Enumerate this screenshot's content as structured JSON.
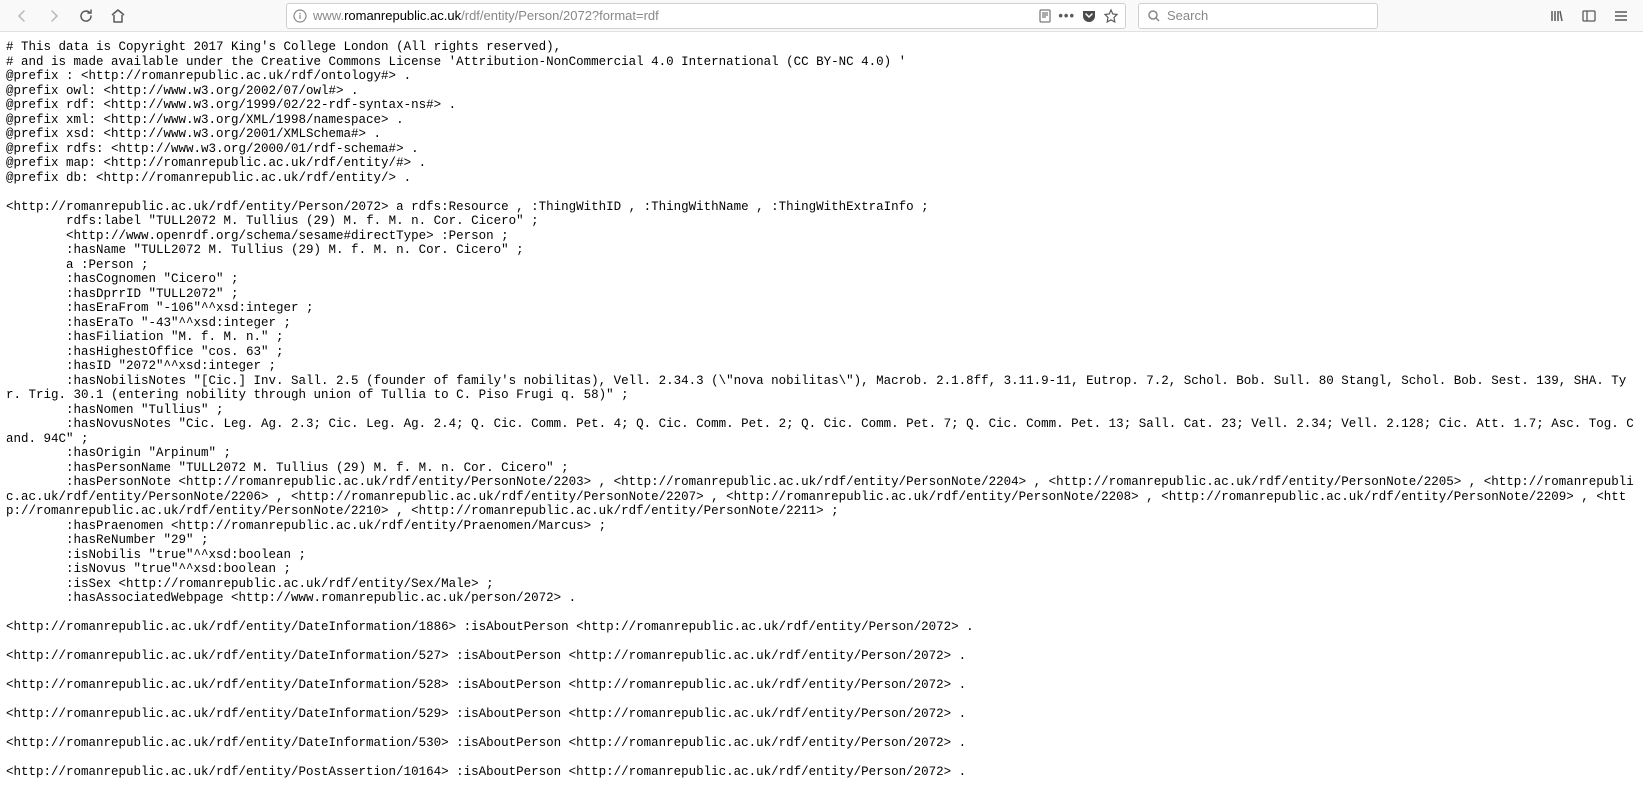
{
  "browser": {
    "url_prefix": "www.",
    "url_domain": "romanrepublic.ac.uk",
    "url_path": "/rdf/entity/Person/2072?format=rdf",
    "search_placeholder": "Search"
  },
  "rdf": {
    "comment1": "# This data is Copyright 2017 King's College London (All rights reserved),",
    "comment2": "# and is made available under the Creative Commons License 'Attribution-NonCommercial 4.0 International (CC BY-NC 4.0) '",
    "prefixes": [
      "@prefix : <http://romanrepublic.ac.uk/rdf/ontology#> .",
      "@prefix owl: <http://www.w3.org/2002/07/owl#> .",
      "@prefix rdf: <http://www.w3.org/1999/02/22-rdf-syntax-ns#> .",
      "@prefix xml: <http://www.w3.org/XML/1998/namespace> .",
      "@prefix xsd: <http://www.w3.org/2001/XMLSchema#> .",
      "@prefix rdfs: <http://www.w3.org/2000/01/rdf-schema#> .",
      "@prefix map: <http://romanrepublic.ac.uk/rdf/entity/#> .",
      "@prefix db: <http://romanrepublic.ac.uk/rdf/entity/> ."
    ],
    "subject_line": "<http://romanrepublic.ac.uk/rdf/entity/Person/2072> a rdfs:Resource , :ThingWithID , :ThingWithName , :ThingWithExtraInfo ;",
    "props": [
      "        rdfs:label \"TULL2072 M. Tullius (29) M. f. M. n. Cor. Cicero\" ;",
      "        <http://www.openrdf.org/schema/sesame#directType> :Person ;",
      "        :hasName \"TULL2072 M. Tullius (29) M. f. M. n. Cor. Cicero\" ;",
      "        a :Person ;",
      "        :hasCognomen \"Cicero\" ;",
      "        :hasDprrID \"TULL2072\" ;",
      "        :hasEraFrom \"-106\"^^xsd:integer ;",
      "        :hasEraTo \"-43\"^^xsd:integer ;",
      "        :hasFiliation \"M. f. M. n.\" ;",
      "        :hasHighestOffice \"cos. 63\" ;",
      "        :hasID \"2072\"^^xsd:integer ;"
    ],
    "nobilis_notes": "        :hasNobilisNotes \"[Cic.] Inv. Sall. 2.5 (founder of family's nobilitas), Vell. 2.34.3 (\\\"nova nobilitas\\\"), Macrob. 2.1.8ff, 3.11.9-11, Eutrop. 7.2, Schol. Bob. Sull. 80 Stangl, Schol. Bob. Sest. 139, SHA. Tyr. Trig. 30.1 (entering nobility through union of Tullia to C. Piso Frugi q. 58)\" ;",
    "nomen": "        :hasNomen \"Tullius\" ;",
    "novus_notes": "        :hasNovusNotes \"Cic. Leg. Ag. 2.3; Cic. Leg. Ag. 2.4; Q. Cic. Comm. Pet. 4; Q. Cic. Comm. Pet. 2; Q. Cic. Comm. Pet. 7; Q. Cic. Comm. Pet. 13; Sall. Cat. 23; Vell. 2.34; Vell. 2.128; Cic. Att. 1.7; Asc. Tog. Cand. 94C\" ;",
    "props2": [
      "        :hasOrigin \"Arpinum\" ;",
      "        :hasPersonName \"TULL2072 M. Tullius (29) M. f. M. n. Cor. Cicero\" ;"
    ],
    "person_notes": "        :hasPersonNote <http://romanrepublic.ac.uk/rdf/entity/PersonNote/2203> , <http://romanrepublic.ac.uk/rdf/entity/PersonNote/2204> , <http://romanrepublic.ac.uk/rdf/entity/PersonNote/2205> , <http://romanrepublic.ac.uk/rdf/entity/PersonNote/2206> , <http://romanrepublic.ac.uk/rdf/entity/PersonNote/2207> , <http://romanrepublic.ac.uk/rdf/entity/PersonNote/2208> , <http://romanrepublic.ac.uk/rdf/entity/PersonNote/2209> , <http://romanrepublic.ac.uk/rdf/entity/PersonNote/2210> , <http://romanrepublic.ac.uk/rdf/entity/PersonNote/2211> ;",
    "props3": [
      "        :hasPraenomen <http://romanrepublic.ac.uk/rdf/entity/Praenomen/Marcus> ;",
      "        :hasReNumber \"29\" ;",
      "        :isNobilis \"true\"^^xsd:boolean ;",
      "        :isNovus \"true\"^^xsd:boolean ;",
      "        :isSex <http://romanrepublic.ac.uk/rdf/entity/Sex/Male> ;",
      "        :hasAssociatedWebpage <http://www.romanrepublic.ac.uk/person/2072> ."
    ],
    "related": [
      "<http://romanrepublic.ac.uk/rdf/entity/DateInformation/1886> :isAboutPerson <http://romanrepublic.ac.uk/rdf/entity/Person/2072> .",
      "<http://romanrepublic.ac.uk/rdf/entity/DateInformation/527> :isAboutPerson <http://romanrepublic.ac.uk/rdf/entity/Person/2072> .",
      "<http://romanrepublic.ac.uk/rdf/entity/DateInformation/528> :isAboutPerson <http://romanrepublic.ac.uk/rdf/entity/Person/2072> .",
      "<http://romanrepublic.ac.uk/rdf/entity/DateInformation/529> :isAboutPerson <http://romanrepublic.ac.uk/rdf/entity/Person/2072> .",
      "<http://romanrepublic.ac.uk/rdf/entity/DateInformation/530> :isAboutPerson <http://romanrepublic.ac.uk/rdf/entity/Person/2072> .",
      "<http://romanrepublic.ac.uk/rdf/entity/PostAssertion/10164> :isAboutPerson <http://romanrepublic.ac.uk/rdf/entity/Person/2072> ."
    ]
  }
}
